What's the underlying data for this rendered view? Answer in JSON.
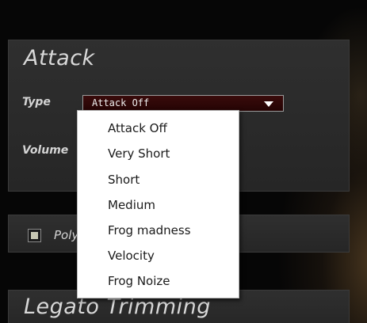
{
  "attack": {
    "title": "Attack",
    "type_label": "Type",
    "volume_label": "Volume",
    "type_selected": "Attack Off",
    "type_options": [
      "Attack Off",
      "Very Short",
      "Short",
      "Medium",
      "Frog madness",
      "Velocity",
      "Frog Noize"
    ]
  },
  "poly": {
    "label": "Poly"
  },
  "legato": {
    "title": "Legato Trimming"
  }
}
